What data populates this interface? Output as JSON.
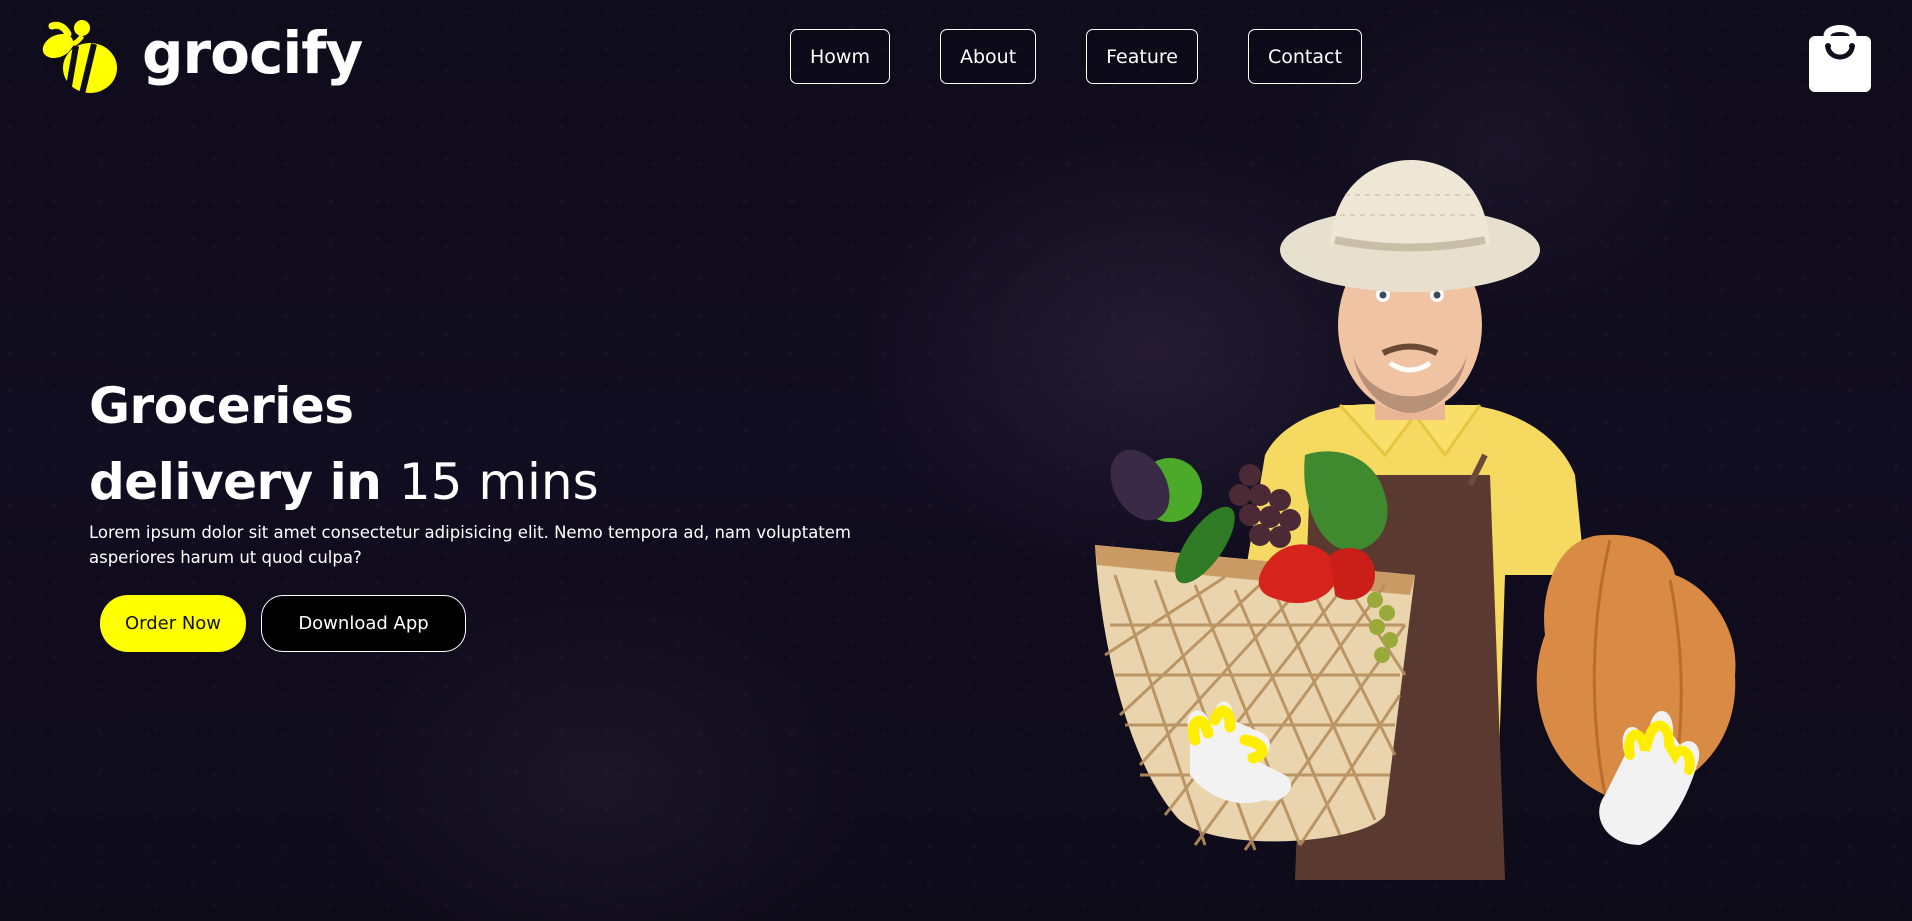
{
  "brand": {
    "name": "grocify",
    "logo_icon": "bee-icon",
    "accent_color": "#ffff00"
  },
  "nav": {
    "items": [
      {
        "label": "Howm"
      },
      {
        "label": "About"
      },
      {
        "label": "Feature"
      },
      {
        "label": "Contact"
      }
    ]
  },
  "header": {
    "cart_icon": "shopping-bag-icon"
  },
  "hero": {
    "title_line1": "Groceries",
    "title_line2_bold": "delivery in",
    "title_line2_light": "15 mins",
    "description": "Lorem ipsum dolor sit amet consectetur adipisicing elit. Nemo tempora ad, nam voluptatem asperiores harum ut quod culpa?",
    "order_button": "Order Now",
    "download_button": "Download App",
    "image_subject": "farmer-with-vegetable-basket"
  }
}
